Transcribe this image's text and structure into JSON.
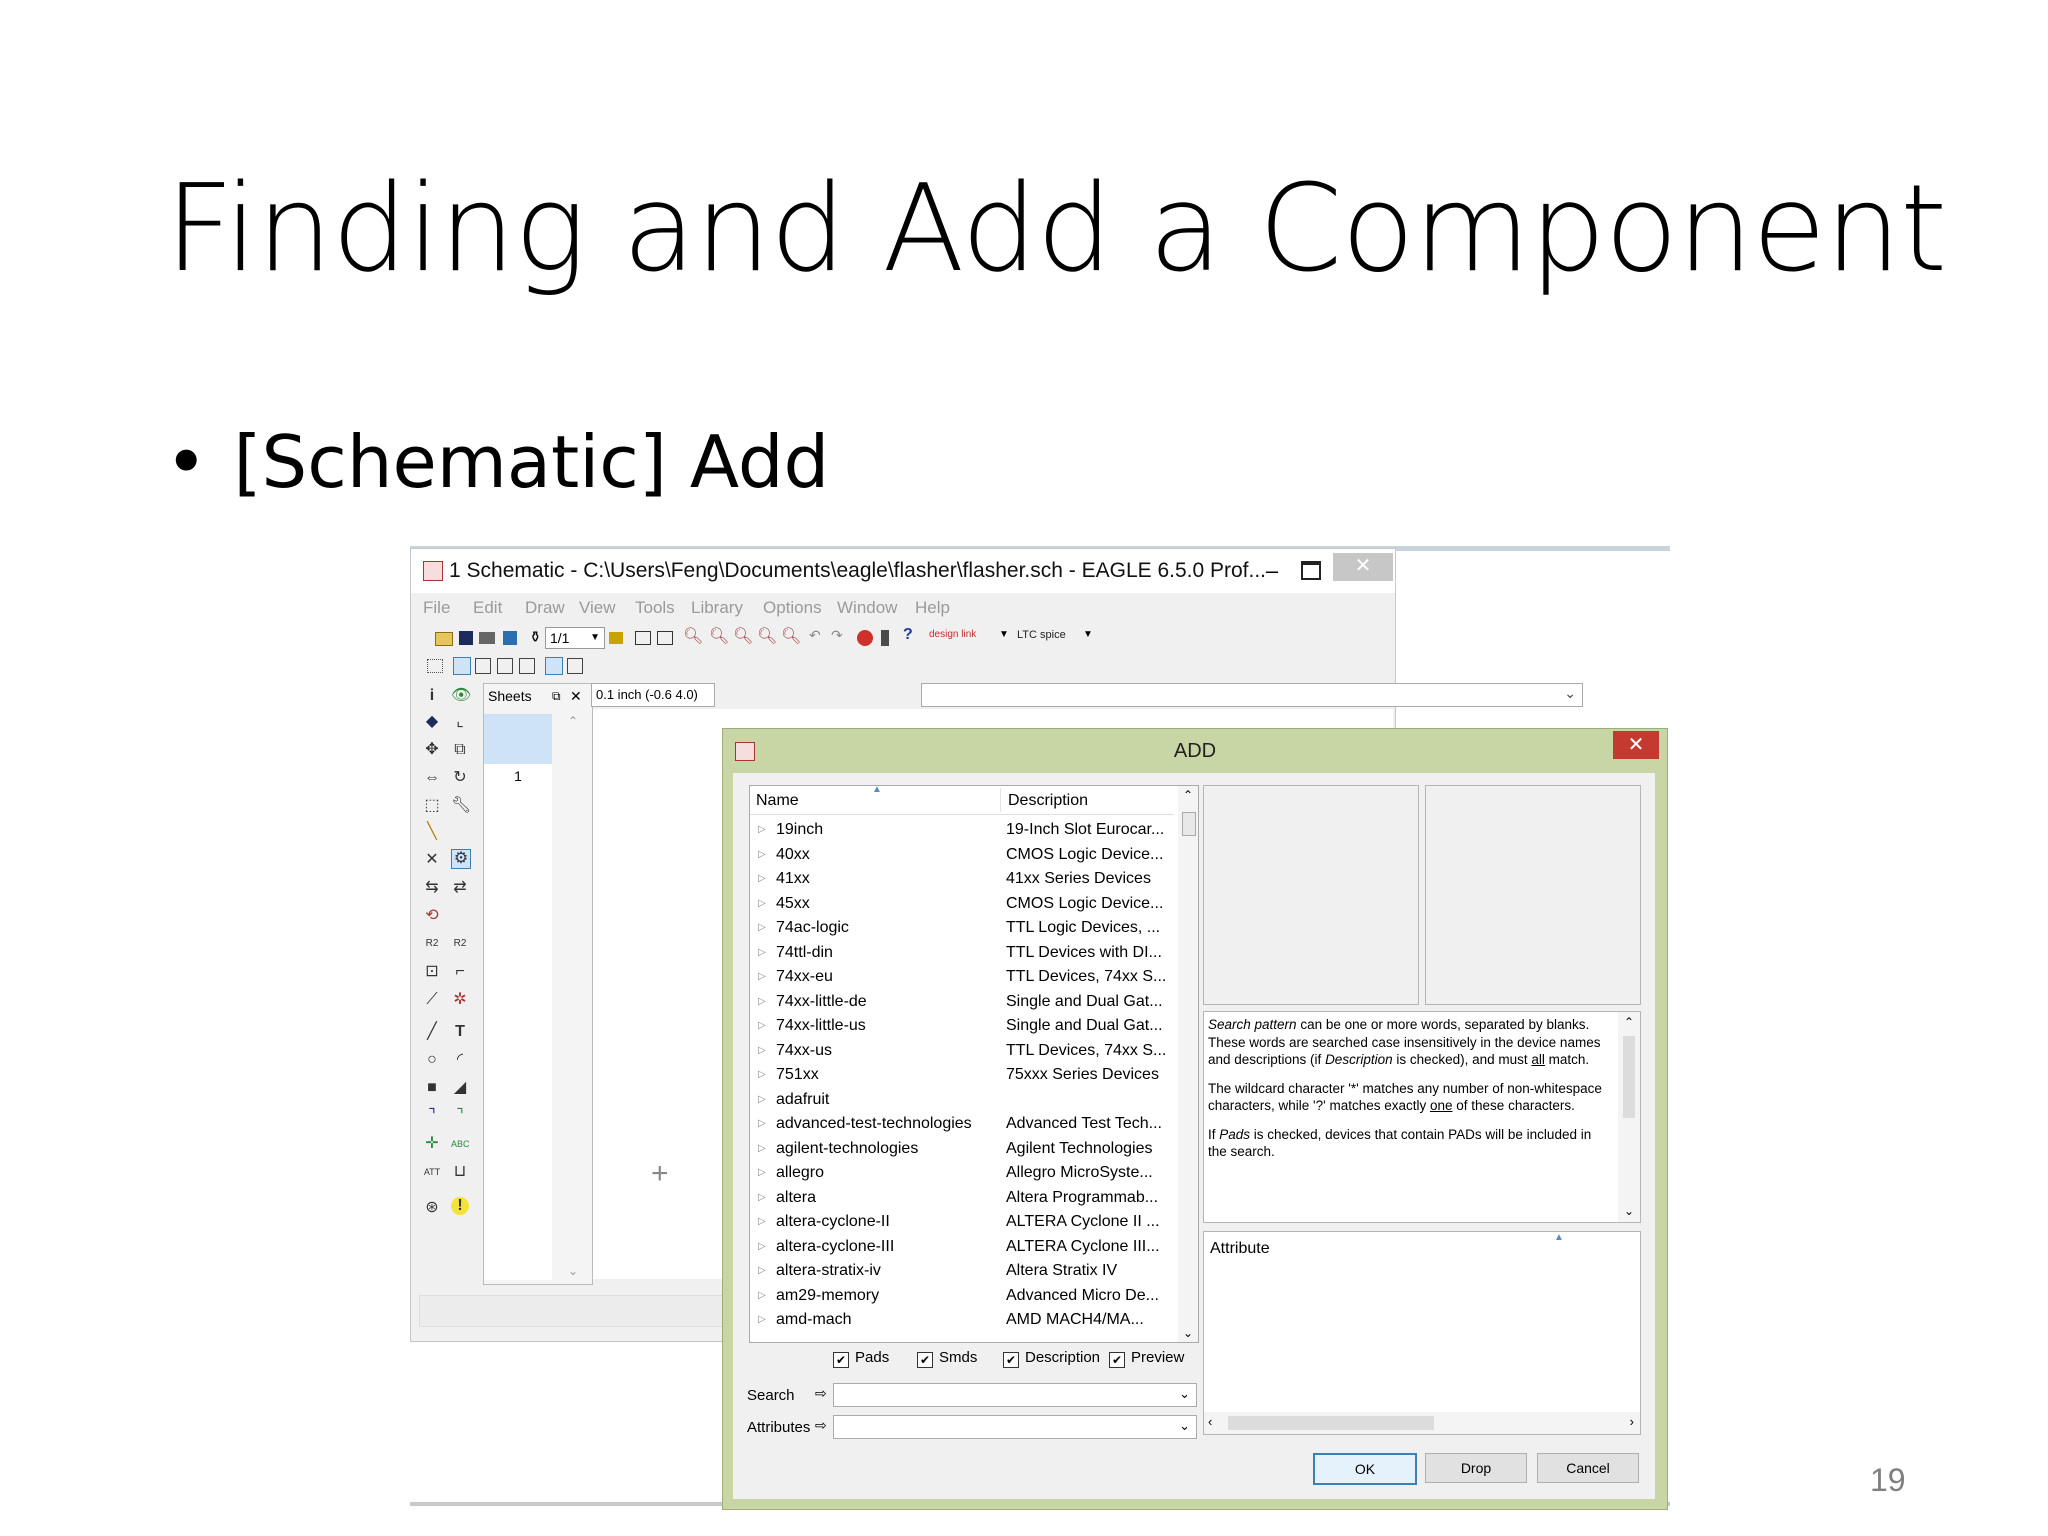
{
  "slide": {
    "title": "Finding and Add a Component",
    "bullet": "[Schematic] Add",
    "page_number": "19"
  },
  "schematic_window": {
    "title": "1 Schematic - C:\\Users\\Feng\\Documents\\eagle\\flasher\\flasher.sch - EAGLE 6.5.0 Prof...",
    "menu": [
      "File",
      "Edit",
      "Draw",
      "View",
      "Tools",
      "Library",
      "Options",
      "Window",
      "Help"
    ],
    "sheet_selector": "1/1",
    "toolbar_brand_1": "design link",
    "toolbar_brand_2": "LTC spice",
    "sheets_panel_title": "Sheets",
    "sheet_number": "1",
    "grid_coord": "0.1 inch (-0.6 4.0)",
    "command_line": ""
  },
  "add_dialog": {
    "title": "ADD",
    "columns": {
      "name": "Name",
      "description": "Description"
    },
    "rows": [
      {
        "name": "19inch",
        "description": "19-Inch Slot Eurocar..."
      },
      {
        "name": "40xx",
        "description": "CMOS Logic Device..."
      },
      {
        "name": "41xx",
        "description": "41xx Series Devices"
      },
      {
        "name": "45xx",
        "description": "CMOS Logic Device..."
      },
      {
        "name": "74ac-logic",
        "description": "TTL Logic Devices, ..."
      },
      {
        "name": "74ttl-din",
        "description": "TTL Devices with DI..."
      },
      {
        "name": "74xx-eu",
        "description": "TTL Devices, 74xx S..."
      },
      {
        "name": "74xx-little-de",
        "description": "Single and Dual Gat..."
      },
      {
        "name": "74xx-little-us",
        "description": "Single and Dual Gat..."
      },
      {
        "name": "74xx-us",
        "description": "TTL Devices, 74xx S..."
      },
      {
        "name": "751xx",
        "description": "75xxx Series Devices"
      },
      {
        "name": "adafruit",
        "description": ""
      },
      {
        "name": "advanced-test-technologies",
        "description": "Advanced Test Tech..."
      },
      {
        "name": "agilent-technologies",
        "description": "Agilent Technologies"
      },
      {
        "name": "allegro",
        "description": "Allegro MicroSyste..."
      },
      {
        "name": "altera",
        "description": "Altera Programmab..."
      },
      {
        "name": "altera-cyclone-II",
        "description": "ALTERA Cyclone II ..."
      },
      {
        "name": "altera-cyclone-III",
        "description": "ALTERA Cyclone III..."
      },
      {
        "name": "altera-stratix-iv",
        "description": "Altera Stratix IV"
      },
      {
        "name": "am29-memory",
        "description": "Advanced Micro De..."
      },
      {
        "name": "amd-mach",
        "description": "AMD MACH4/MA..."
      }
    ],
    "checkboxes": {
      "pads": "Pads",
      "smds": "Smds",
      "description": "Description",
      "preview": "Preview"
    },
    "search_label": "Search",
    "attributes_label": "Attributes",
    "search_value": "",
    "attributes_value": "",
    "help": {
      "p1_em": "Search pattern",
      "p1_a": " can be one or more words, separated by blanks. These words are searched case insensitively in the device names and descriptions (if ",
      "p1_em2": "Description",
      "p1_b": " is checked), and must ",
      "p1_u": "all",
      "p1_c": " match.",
      "p2_a": "The wildcard character '*' matches any number of non-whitespace characters, while '?' matches exactly ",
      "p2_u": "one",
      "p2_b": " of these characters.",
      "p3_a": "If ",
      "p3_em": "Pads",
      "p3_b": " is checked, devices that contain PADs will be included in the search."
    },
    "attribute_column": "Attribute",
    "buttons": {
      "ok": "OK",
      "drop": "Drop",
      "cancel": "Cancel"
    }
  }
}
